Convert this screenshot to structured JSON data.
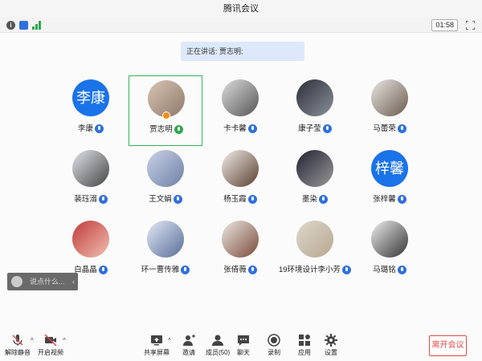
{
  "window": {
    "title": "腾讯会议"
  },
  "toolbar": {
    "timer": "01:58",
    "info_icon": "info-icon",
    "shield_icon": "shield-icon",
    "signal_icon": "signal-icon",
    "fullscreen_icon": "fullscreen-icon"
  },
  "speaking": {
    "label": "正在讲话: 贾志明;"
  },
  "participants": [
    {
      "name": "李康",
      "avatar_text": "李康",
      "mic": "on"
    },
    {
      "name": "贾志明",
      "avatar_text": "",
      "mic": "speaking",
      "host": true
    },
    {
      "name": "卡卡馨",
      "avatar_text": "",
      "mic": "on"
    },
    {
      "name": "康子莹",
      "avatar_text": "",
      "mic": "on"
    },
    {
      "name": "马蕾荣",
      "avatar_text": "",
      "mic": "on"
    },
    {
      "name": "裴珏溺",
      "avatar_text": "",
      "mic": "on"
    },
    {
      "name": "王文娟",
      "avatar_text": "",
      "mic": "on"
    },
    {
      "name": "杨玉霞",
      "avatar_text": "",
      "mic": "on"
    },
    {
      "name": "墨染",
      "avatar_text": "",
      "mic": "on"
    },
    {
      "name": "张梓馨",
      "avatar_text": "梓馨",
      "mic": "on"
    },
    {
      "name": "白晶晶",
      "avatar_text": "",
      "mic": "on"
    },
    {
      "name": "环一曹传雅",
      "avatar_text": "",
      "mic": "on"
    },
    {
      "name": "张倩薇",
      "avatar_text": "",
      "mic": "on"
    },
    {
      "name": "19环境设计李小芳",
      "avatar_text": "",
      "mic": "on"
    },
    {
      "name": "马璐铭",
      "avatar_text": "",
      "mic": "on"
    }
  ],
  "chat": {
    "placeholder": "说点什么...",
    "collapse_glyph": "‹"
  },
  "bottombar": {
    "unmute": "解除静音",
    "start_video": "开启视频",
    "share_screen": "共享屏幕",
    "invite": "邀请",
    "members": "成员(50)",
    "chat": "聊天",
    "record": "录制",
    "apps": "应用",
    "settings": "设置",
    "leave": "离开会议"
  },
  "colors": {
    "accent": "#1a73e8",
    "speaking_green": "#35b35c",
    "leave_red": "#e24848"
  }
}
